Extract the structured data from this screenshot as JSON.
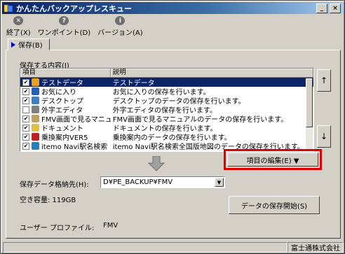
{
  "window": {
    "title": "かんたんバックアップレスキュー",
    "minimize": "_",
    "close": "×"
  },
  "toolbar": {
    "items": [
      {
        "label": "終了(X)",
        "icon": "x-icon",
        "glyph": "✕"
      },
      {
        "label": "ワンポイント(D)",
        "icon": "help-icon",
        "glyph": "?"
      },
      {
        "label": "バージョン(A)",
        "icon": "info-icon",
        "glyph": "i"
      }
    ]
  },
  "tab": {
    "label": "保存(B)"
  },
  "save_section": {
    "label": "保存する内容(I)",
    "columns": [
      "項目",
      "説明"
    ],
    "rows": [
      {
        "checked": "✔",
        "name": "テストデータ",
        "desc": "テストデータ",
        "icon_color": "#e8a020"
      },
      {
        "checked": "✔",
        "name": "お気に入り",
        "desc": "お気に入りの保存を行います。",
        "icon_color": "#2060c0"
      },
      {
        "checked": "✔",
        "name": "デスクトップ",
        "desc": "デスクトップのデータの保存を行います。",
        "icon_color": "#4080c0"
      },
      {
        "checked": "",
        "name": "外字エディタ",
        "desc": "外字エディタの保存を行います。",
        "icon_color": "#808080"
      },
      {
        "checked": "✔",
        "name": "FMV画面で見るマニュ...",
        "desc": "FMV画面で見るマニュアルのデータの保存を行います。",
        "icon_color": "#c0a060"
      },
      {
        "checked": "✔",
        "name": "ドキュメント",
        "desc": "ドキュメントの保存を行います。",
        "icon_color": "#e0c040"
      },
      {
        "checked": "✔",
        "name": "乗換案内VER5",
        "desc": "乗換案内のデータの保存を行います。",
        "icon_color": "#c02020"
      },
      {
        "checked": "✔",
        "name": "itemo Navi駅名検索",
        "desc": "itemo Navi駅名検索全国版地図のデータの保存を行います。",
        "icon_color": "#2080c0"
      }
    ],
    "selected_index": 0,
    "move_up": "↑",
    "move_down": "↓"
  },
  "edit_items_button": {
    "label": "項目の編集(E) ▼"
  },
  "destination": {
    "label": "保存データ格納先(H):",
    "value": "D¥PE_BACKUP¥FMV",
    "free_space": "空き容量: 119GB"
  },
  "start_button": {
    "label": "データの保存開始(S)"
  },
  "user_profile": {
    "label": "ユーザー プロファイル:",
    "value": "FMV"
  },
  "statusbar": {
    "company": "富士通株式会社"
  },
  "colors": {
    "highlight": "#e00000",
    "selection": "#0a246a",
    "face": "#d4d0c8"
  }
}
